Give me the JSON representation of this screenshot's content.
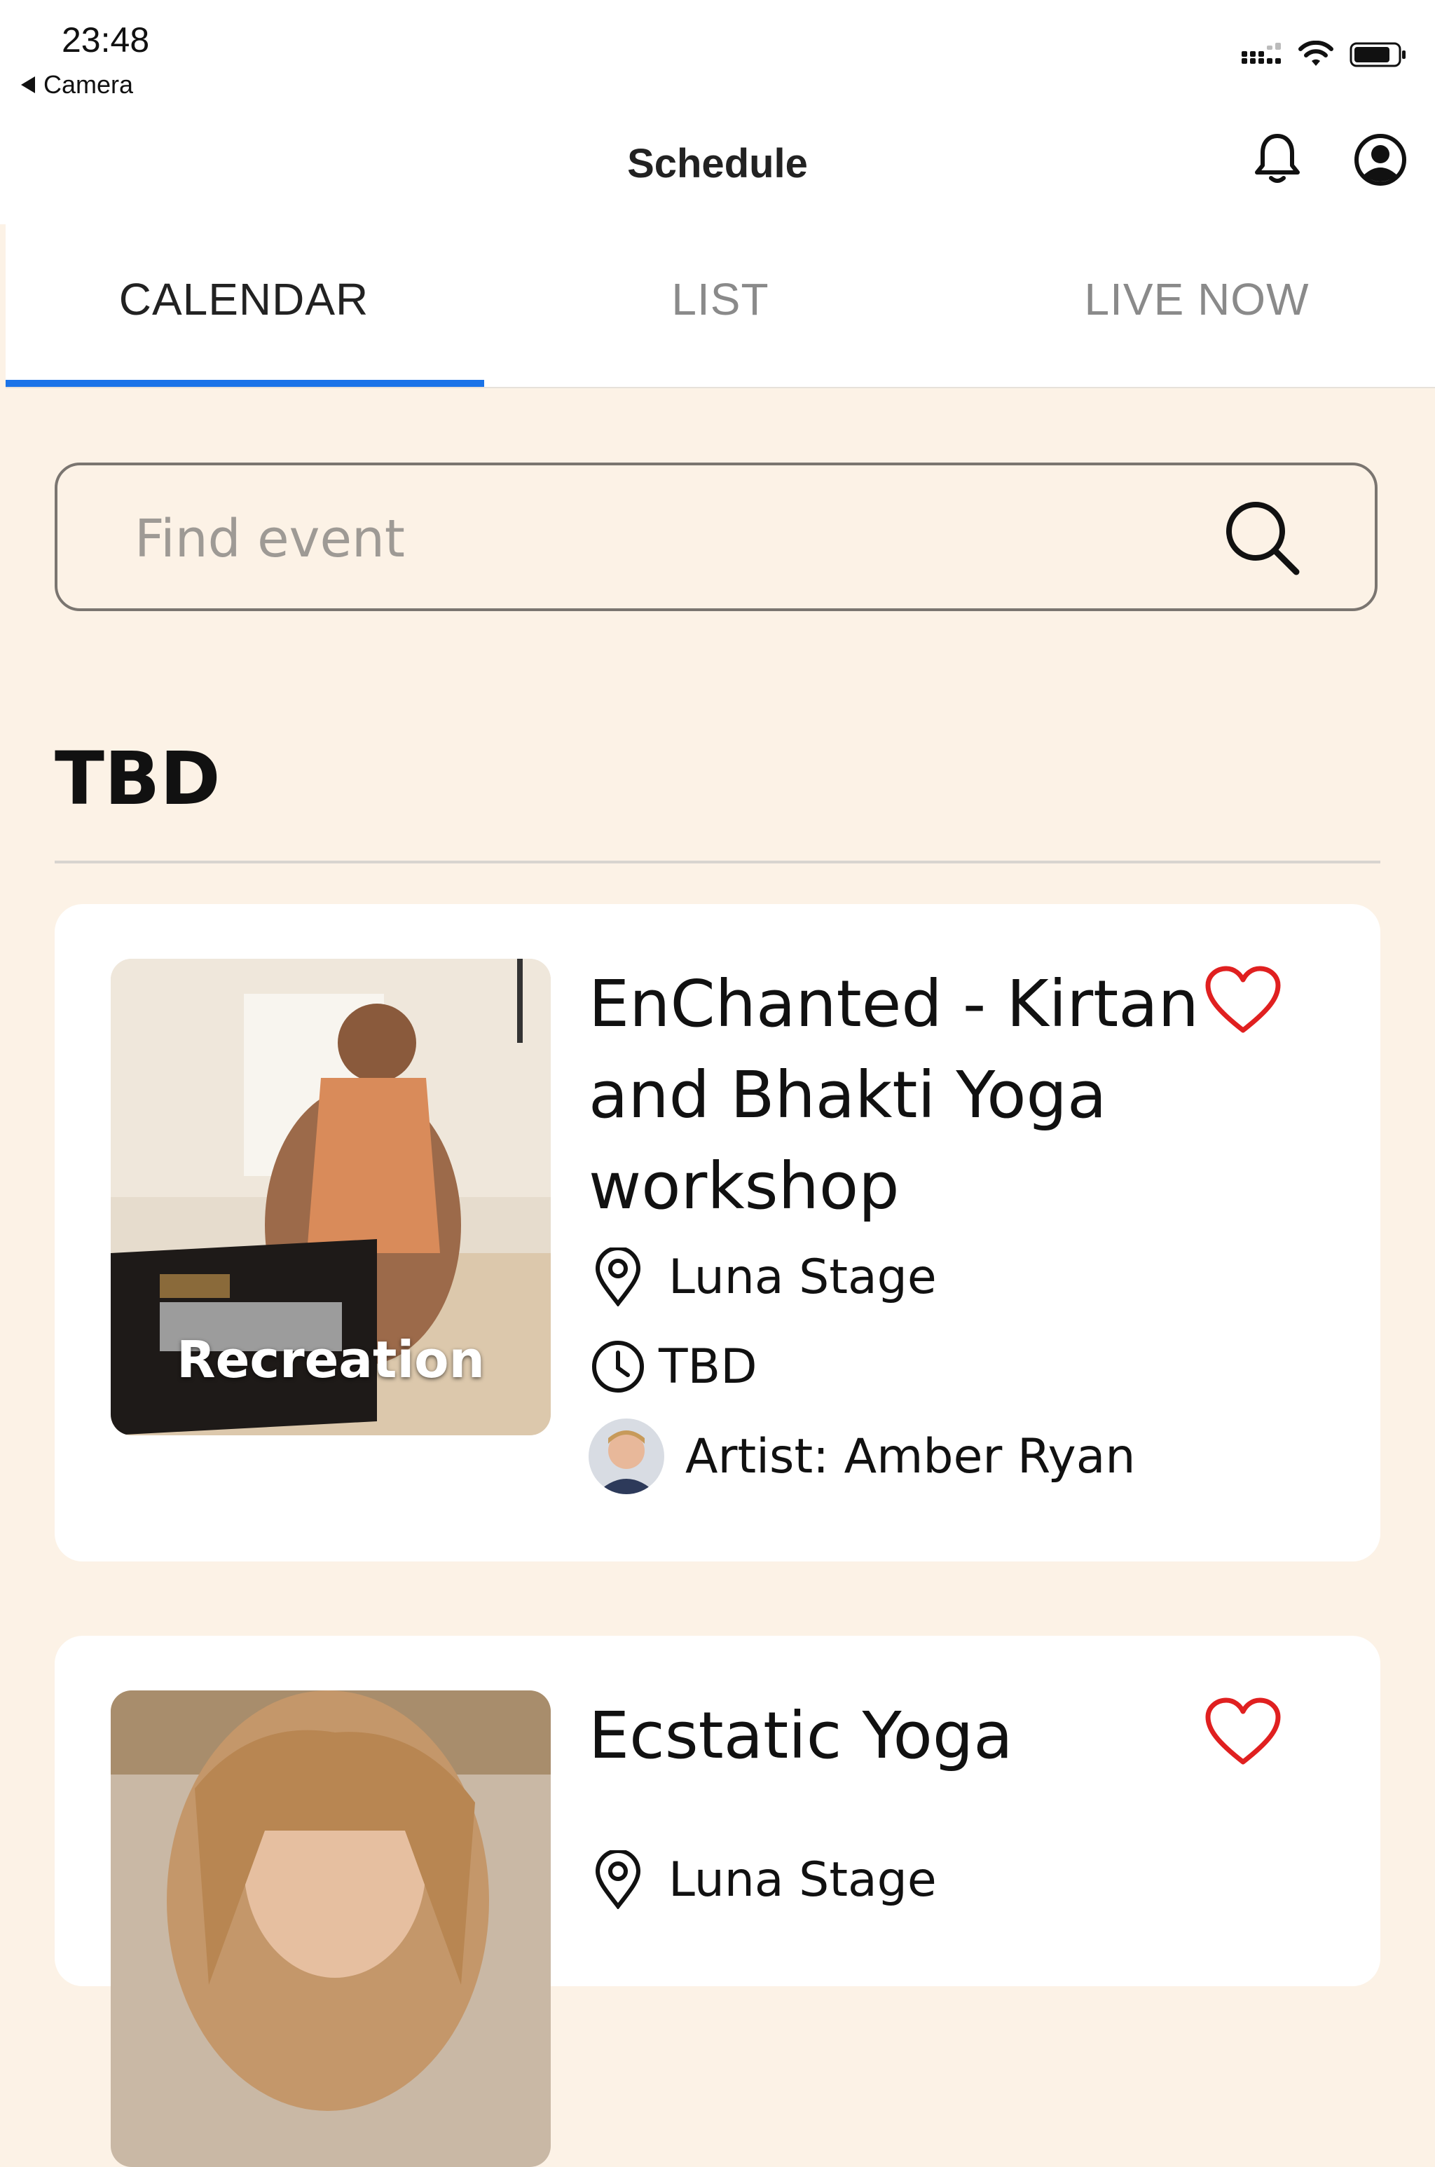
{
  "status_bar": {
    "time": "23:48",
    "back_label": "Camera"
  },
  "header": {
    "title": "Schedule",
    "icons": [
      "bell-icon",
      "account-circle-icon"
    ]
  },
  "tabs": [
    {
      "label": "CALENDAR",
      "active": true
    },
    {
      "label": "LIST",
      "active": false
    },
    {
      "label": "LIVE NOW",
      "active": false
    }
  ],
  "search": {
    "placeholder": "Find event"
  },
  "section": {
    "title": "TBD"
  },
  "events": [
    {
      "title": "EnChanted - Kirtan and Bhakti Yoga workshop",
      "category": "Recreation",
      "location": "Luna Stage",
      "time": "TBD",
      "artist": "Artist: Amber Ryan",
      "favorite": false
    },
    {
      "title": "Ecstatic Yoga",
      "location": "Luna Stage",
      "favorite": false
    }
  ],
  "colors": {
    "background": "#fcf2e6",
    "accent": "#1a73e8",
    "heart": "#e02020"
  }
}
